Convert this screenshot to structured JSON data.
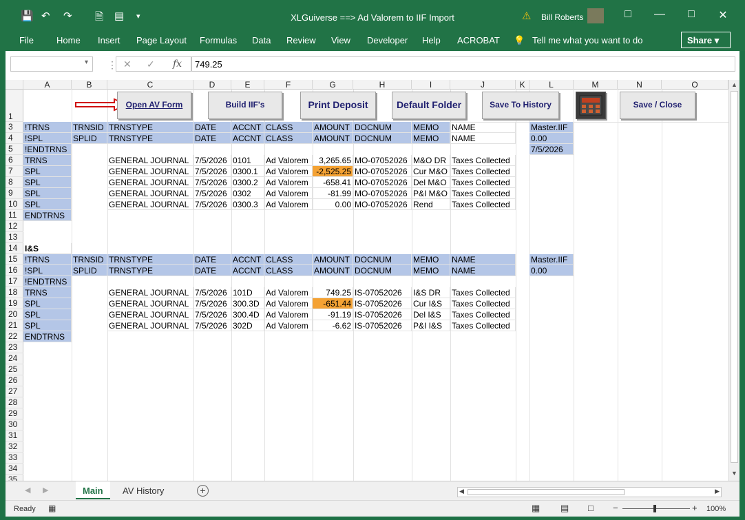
{
  "window": {
    "title": "XLGuiverse ==> Ad Valorem to IIF Import",
    "user": "Bill Roberts",
    "warning_icon": "warning-icon"
  },
  "ribbon": {
    "tabs": [
      "File",
      "Home",
      "Insert",
      "Page Layout",
      "Formulas",
      "Data",
      "Review",
      "View",
      "Developer",
      "Help",
      "ACROBAT"
    ],
    "tell_me": "Tell me what you want to do",
    "share": "Share"
  },
  "formula": {
    "value": "749.25",
    "fx": "fx"
  },
  "columns": [
    "A",
    "B",
    "C",
    "D",
    "E",
    "F",
    "G",
    "H",
    "I",
    "J",
    "K",
    "L",
    "M",
    "N",
    "O"
  ],
  "buttons": {
    "open_av": "Open AV Form",
    "build_iif": "Build IIF's",
    "print_deposit": "Print Deposit",
    "default_folder": "Default Folder",
    "save_history": "Save To History",
    "save_close": "Save / Close"
  },
  "rows": {
    "r3": {
      "A": "!TRNS",
      "B": "TRNSID",
      "C": "TRNSTYPE",
      "D": "DATE",
      "E": "ACCNT",
      "F": "CLASS",
      "G": "AMOUNT",
      "H": "DOCNUM",
      "I": "MEMO",
      "J": "NAME",
      "L": "Master.IIF"
    },
    "r4": {
      "A": "!SPL",
      "B": "SPLID",
      "C": "TRNSTYPE",
      "D": "DATE",
      "E": "ACCNT",
      "F": "CLASS",
      "G": "AMOUNT",
      "H": "DOCNUM",
      "I": "MEMO",
      "J": "NAME",
      "L": "0.00"
    },
    "r5": {
      "A": "!ENDTRNS",
      "L": "7/5/2026"
    },
    "r6": {
      "A": "TRNS",
      "C": "GENERAL JOURNAL",
      "D": "7/5/2026",
      "E": "0101",
      "F": "Ad Valorem",
      "G": "3,265.65",
      "H": "MO-07052026",
      "I": "M&O DR",
      "J": "Taxes Collected"
    },
    "r7": {
      "A": "SPL",
      "C": "GENERAL JOURNAL",
      "D": "7/5/2026",
      "E": "0300.1",
      "F": "Ad Valorem",
      "G": "-2,525.25",
      "H": "MO-07052026",
      "I": "Cur M&O",
      "J": "Taxes Collected"
    },
    "r8": {
      "A": "SPL",
      "C": "GENERAL JOURNAL",
      "D": "7/5/2026",
      "E": "0300.2",
      "F": "Ad Valorem",
      "G": "-658.41",
      "H": "MO-07052026",
      "I": "Del M&O",
      "J": "Taxes Collected"
    },
    "r9": {
      "A": "SPL",
      "C": "GENERAL JOURNAL",
      "D": "7/5/2026",
      "E": "0302",
      "F": "Ad Valorem",
      "G": "-81.99",
      "H": "MO-07052026",
      "I": "P&I M&O",
      "J": "Taxes Collected"
    },
    "r10": {
      "A": "SPL",
      "C": "GENERAL JOURNAL",
      "D": "7/5/2026",
      "E": "0300.3",
      "F": "Ad Valorem",
      "G": "0.00",
      "H": "MO-07052026",
      "I": "Rend",
      "J": "Taxes Collected"
    },
    "r11": {
      "A": "ENDTRNS"
    },
    "r14": {
      "A": "I&S"
    },
    "r15": {
      "A": "!TRNS",
      "B": "TRNSID",
      "C": "TRNSTYPE",
      "D": "DATE",
      "E": "ACCNT",
      "F": "CLASS",
      "G": "AMOUNT",
      "H": "DOCNUM",
      "I": "MEMO",
      "J": "NAME",
      "L": "Master.IIF"
    },
    "r16": {
      "A": "!SPL",
      "B": "SPLID",
      "C": "TRNSTYPE",
      "D": "DATE",
      "E": "ACCNT",
      "F": "CLASS",
      "G": "AMOUNT",
      "H": "DOCNUM",
      "I": "MEMO",
      "J": "NAME",
      "L": "0.00"
    },
    "r17": {
      "A": "!ENDTRNS"
    },
    "r18": {
      "A": "TRNS",
      "C": "GENERAL JOURNAL",
      "D": "7/5/2026",
      "E": "101D",
      "F": "Ad Valorem",
      "G": "749.25",
      "H": "IS-07052026",
      "I": "I&S DR",
      "J": "Taxes Collected"
    },
    "r19": {
      "A": "SPL",
      "C": "GENERAL JOURNAL",
      "D": "7/5/2026",
      "E": "300.3D",
      "F": "Ad Valorem",
      "G": "-651.44",
      "H": "IS-07052026",
      "I": "Cur I&S",
      "J": "Taxes Collected"
    },
    "r20": {
      "A": "SPL",
      "C": "GENERAL JOURNAL",
      "D": "7/5/2026",
      "E": "300.4D",
      "F": "Ad Valorem",
      "G": "-91.19",
      "H": "IS-07052026",
      "I": "Del I&S",
      "J": "Taxes Collected"
    },
    "r21": {
      "A": "SPL",
      "C": "GENERAL JOURNAL",
      "D": "7/5/2026",
      "E": "302D",
      "F": "Ad Valorem",
      "G": "-6.62",
      "H": "IS-07052026",
      "I": "P&I I&S",
      "J": "Taxes Collected"
    },
    "r22": {
      "A": "ENDTRNS"
    }
  },
  "row_numbers": [
    "1",
    "3",
    "4",
    "5",
    "6",
    "7",
    "8",
    "9",
    "10",
    "11",
    "12",
    "13",
    "14",
    "15",
    "16",
    "17",
    "18",
    "19",
    "20",
    "21",
    "22",
    "23",
    "24",
    "25",
    "26",
    "27",
    "28",
    "29",
    "30",
    "31",
    "32",
    "33",
    "34",
    "35"
  ],
  "sheets": {
    "active": "Main",
    "other": "AV History",
    "add": "+"
  },
  "status": {
    "ready": "Ready",
    "zoom": "100%"
  },
  "colors": {
    "accent": "#217346",
    "header_fill": "#b4c6e7",
    "highlight": "#f4a234"
  }
}
